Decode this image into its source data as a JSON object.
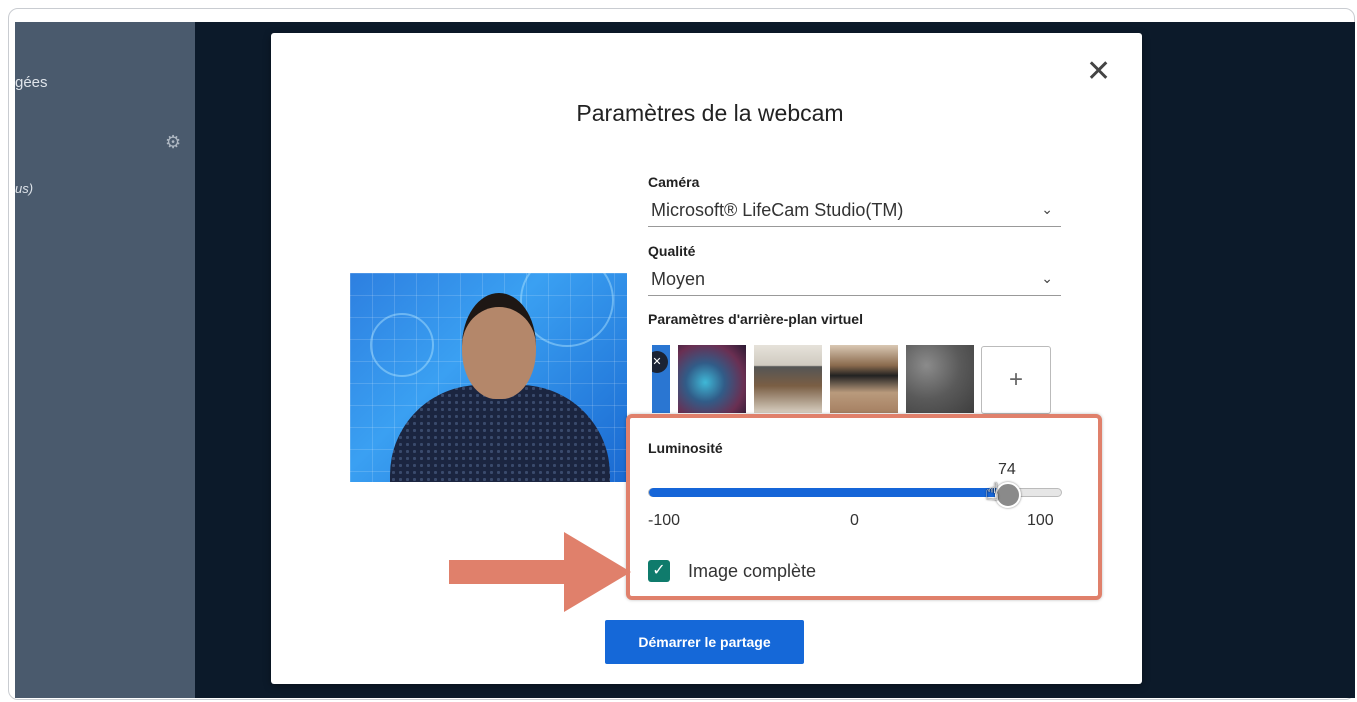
{
  "sidebar": {
    "label_top": "gées",
    "label_italic": "us)"
  },
  "dialog": {
    "title": "Paramètres de la webcam",
    "close_icon": "close-icon",
    "camera": {
      "label": "Caméra",
      "value": "Microsoft® LifeCam Studio(TM)"
    },
    "quality": {
      "label": "Qualité",
      "value": "Moyen"
    },
    "virtual_bg": {
      "label": "Paramètres d'arrière-plan virtuel",
      "add_label": "+"
    },
    "brightness": {
      "label": "Luminosité",
      "value": "74",
      "min_label": "-100",
      "mid_label": "0",
      "max_label": "100",
      "min": -100,
      "max": 100,
      "current": 74
    },
    "full_image": {
      "label": "Image complète",
      "checked": true
    },
    "start_button": "Démarrer le partage"
  },
  "colors": {
    "accent": "#1568d8",
    "highlight": "#e0806b",
    "checkbox": "#0f7b6c"
  }
}
